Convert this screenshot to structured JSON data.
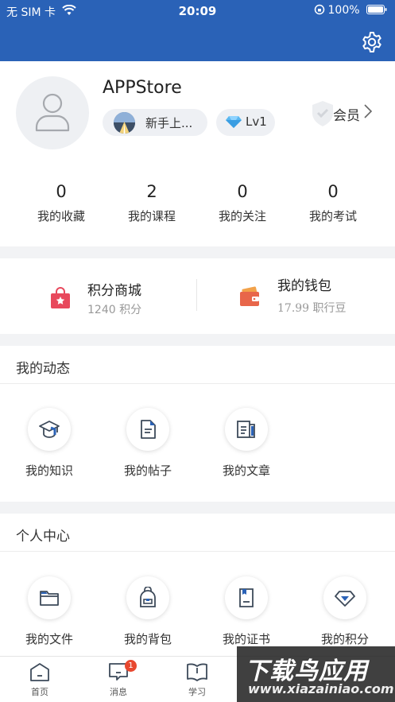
{
  "status_bar": {
    "carrier": "无 SIM 卡",
    "time": "20:09",
    "battery": "100%"
  },
  "profile": {
    "username": "APPStore",
    "level_badge": "新手上...",
    "lv": "Lv1",
    "member_label": "会员"
  },
  "stats": [
    {
      "value": "0",
      "label": "我的收藏"
    },
    {
      "value": "2",
      "label": "我的课程"
    },
    {
      "value": "0",
      "label": "我的关注"
    },
    {
      "value": "0",
      "label": "我的考试"
    }
  ],
  "points_mall": {
    "title": "积分商城",
    "sub": "1240 积分"
  },
  "wallet": {
    "title": "我的钱包",
    "sub": "17.99 职行豆"
  },
  "dynamics": {
    "title": "我的动态",
    "items": [
      {
        "label": "我的知识",
        "icon": "graduation-cap-icon"
      },
      {
        "label": "我的帖子",
        "icon": "document-icon"
      },
      {
        "label": "我的文章",
        "icon": "article-icon"
      }
    ]
  },
  "personal_center": {
    "title": "个人中心",
    "items": [
      {
        "label": "我的文件",
        "icon": "folder-icon"
      },
      {
        "label": "我的背包",
        "icon": "backpack-icon"
      },
      {
        "label": "我的证书",
        "icon": "certificate-icon"
      },
      {
        "label": "我的积分",
        "icon": "diamond-icon"
      }
    ]
  },
  "tabbar": {
    "tabs": [
      {
        "label": "首页",
        "icon": "home-icon"
      },
      {
        "label": "消息",
        "icon": "message-icon",
        "badge": "1"
      },
      {
        "label": "学习",
        "icon": "book-icon"
      }
    ]
  },
  "watermark": {
    "main": "下载鸟应用",
    "sub": "www.xiazainiao.com"
  },
  "colors": {
    "brand_blue": "#2a62b7",
    "badge_red": "#e8482f",
    "mall_red": "#e8485c",
    "wallet_orange": "#e8664a"
  }
}
